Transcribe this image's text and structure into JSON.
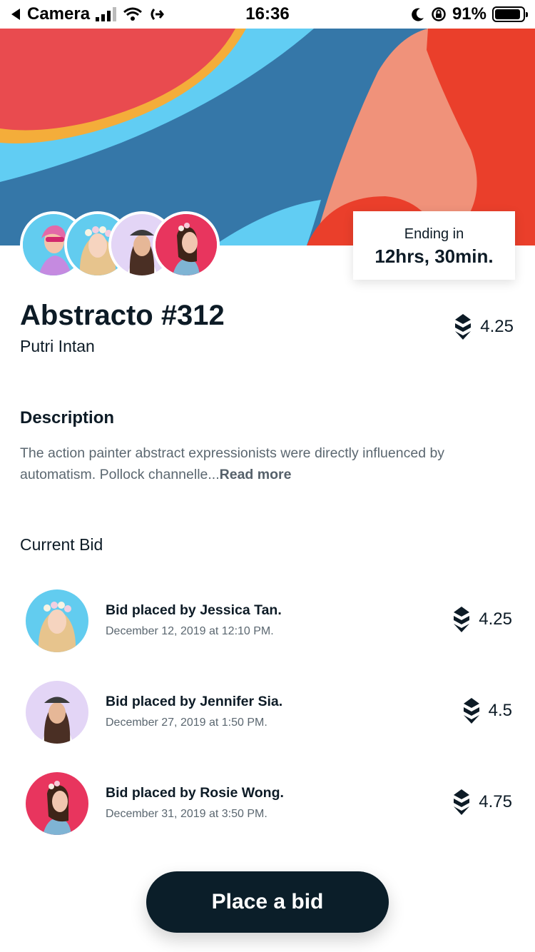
{
  "status_bar": {
    "back_app": "Camera",
    "time": "16:36",
    "battery": "91%",
    "battery_level": 0.91
  },
  "artwork": {
    "title": "Abstracto #312",
    "artist": "Putri Intan",
    "price": "4.25",
    "price_icon": "crypto-coin-icon"
  },
  "ending": {
    "label": "Ending in",
    "value": "12hrs, 30min."
  },
  "description": {
    "heading": "Description",
    "text": "The action painter abstract expressionists were directly influenced by automatism. Pollock channelle...",
    "read_more": "Read more"
  },
  "bids": {
    "heading": "Current Bid",
    "items": [
      {
        "name": "Bid placed by Jessica Tan.",
        "date": "December 12, 2019 at 12:10 PM.",
        "amount": "4.25",
        "avatar_bg": "#62ccef"
      },
      {
        "name": "Bid placed by Jennifer Sia.",
        "date": "December 27, 2019 at 1:50 PM.",
        "amount": "4.5",
        "avatar_bg": "#e3d5f6"
      },
      {
        "name": "Bid placed by Rosie Wong.",
        "date": "December 31, 2019 at 3:50 PM.",
        "amount": "4.75",
        "avatar_bg": "#e8355e"
      }
    ]
  },
  "cta": {
    "label": "Place a bid"
  },
  "colors": {
    "primary_dark": "#0b1e29",
    "text_muted": "#5b6770",
    "hero_red": "#e94b4f",
    "hero_blue": "#3577a8",
    "hero_cyan": "#61cdf3",
    "hero_salmon": "#f0927a",
    "hero_orange": "#ea3f2b"
  }
}
